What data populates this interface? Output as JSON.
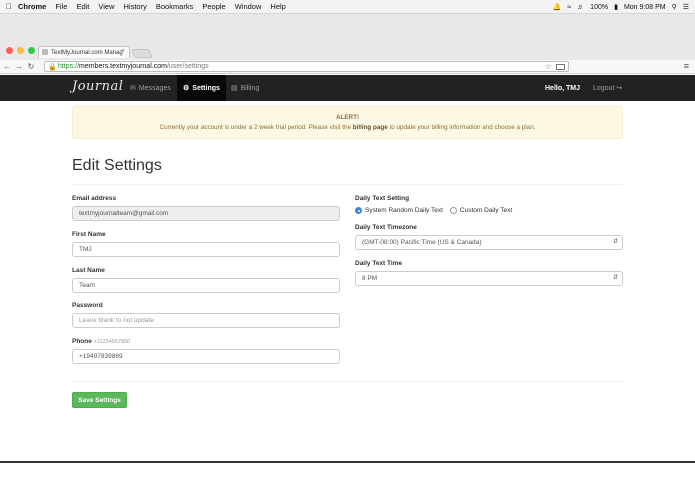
{
  "menubar": {
    "app": "Chrome",
    "items": [
      "File",
      "Edit",
      "View",
      "History",
      "Bookmarks",
      "People",
      "Window",
      "Help"
    ],
    "battery": "100%",
    "clock": "Mon 9:08 PM"
  },
  "browser": {
    "tab_title": "TextMyJournal.com Manag",
    "url_scheme": "https://",
    "url_host": "members.textmyjournal.com",
    "url_path": "/user/settings"
  },
  "sitenav": {
    "brand": "Journal",
    "links": [
      {
        "label": "Messages",
        "icon": "envelope-icon"
      },
      {
        "label": "Settings",
        "icon": "gear-icon"
      },
      {
        "label": "Billing",
        "icon": "credit-card-icon"
      }
    ],
    "greeting": "Hello, TMJ",
    "logout": "Logout"
  },
  "alert": {
    "title": "ALERT!",
    "text_before": "Currently your account is under a 2 week trial period. Please visit the",
    "link": "billing page",
    "text_after": "to update your billing information and choose a plan."
  },
  "page": {
    "title": "Edit Settings"
  },
  "form": {
    "email_label": "Email address",
    "email_value": "textmyjournalteam@gmail.com",
    "first_name_label": "First Name",
    "first_name_value": "TMJ",
    "last_name_label": "Last Name",
    "last_name_value": "Team",
    "password_label": "Password",
    "password_placeholder": "Leave blank to not update",
    "phone_label": "Phone",
    "phone_hint": "+11234567890",
    "phone_value": "+19497839869",
    "daily_text_setting_label": "Daily Text Setting",
    "radio_random": "System Random Daily Text",
    "radio_custom": "Custom Daily Text",
    "timezone_label": "Daily Text Timezone",
    "timezone_value": "(GMT-08:00) Pacific Time (US & Canada)",
    "time_label": "Daily Text Time",
    "time_value": "8 PM",
    "save_label": "Save Settings"
  }
}
